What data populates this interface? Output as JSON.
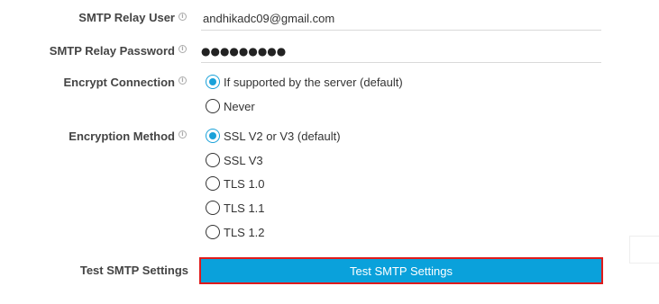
{
  "fields": {
    "relay_user": {
      "label": "SMTP Relay User",
      "value": "andhikadc09@gmail.com"
    },
    "relay_password": {
      "label": "SMTP Relay Password",
      "masked_value": "●●●●●●●●●"
    }
  },
  "encrypt_connection": {
    "label": "Encrypt Connection",
    "options": [
      {
        "label": "If supported by the server (default)",
        "checked": true
      },
      {
        "label": "Never",
        "checked": false
      }
    ]
  },
  "encryption_method": {
    "label": "Encryption Method",
    "options": [
      {
        "label": "SSL V2 or V3 (default)",
        "checked": true
      },
      {
        "label": "SSL V3",
        "checked": false
      },
      {
        "label": "TLS 1.0",
        "checked": false
      },
      {
        "label": "TLS 1.1",
        "checked": false
      },
      {
        "label": "TLS 1.2",
        "checked": false
      }
    ]
  },
  "test_settings": {
    "label": "Test SMTP Settings",
    "button_label": "Test SMTP Settings"
  },
  "info_icon_glyph": "i",
  "colors": {
    "accent": "#19a1d9",
    "button_bg": "#0aa1db",
    "button_border": "#e01b1b"
  },
  "icons": [
    "info-icon",
    "radio-checked-icon",
    "radio-unchecked-icon"
  ]
}
